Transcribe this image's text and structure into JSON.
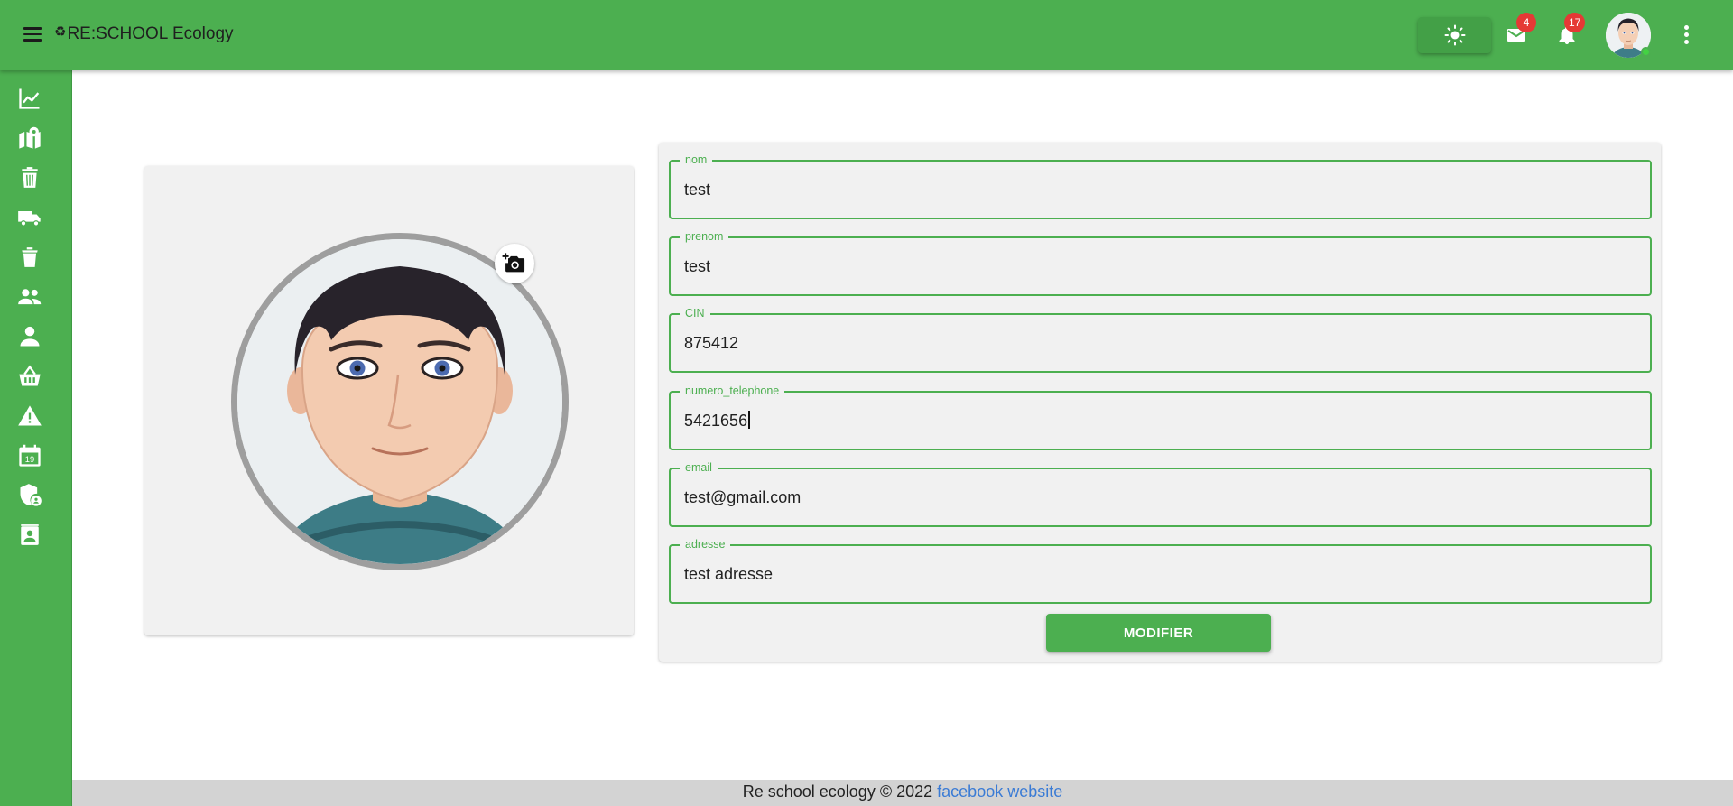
{
  "header": {
    "brand_icon": "recycle-icon",
    "title": "RE:SCHOOL Ecology",
    "messages_count": "4",
    "notifications_count": "17",
    "accent_color": "#4caf50"
  },
  "sidebar": {
    "items": [
      {
        "icon": "chart-line-icon"
      },
      {
        "icon": "map-marker-icon"
      },
      {
        "icon": "trash-bin-icon"
      },
      {
        "icon": "truck-icon"
      },
      {
        "icon": "trash-can-icon"
      },
      {
        "icon": "people-icon"
      },
      {
        "icon": "person-icon"
      },
      {
        "icon": "basket-icon"
      },
      {
        "icon": "warning-icon"
      },
      {
        "icon": "calendar-icon",
        "text": "19"
      },
      {
        "icon": "shield-account-icon"
      },
      {
        "icon": "contact-card-icon"
      }
    ]
  },
  "form": {
    "fields": [
      {
        "label": "nom",
        "value": "test"
      },
      {
        "label": "prenom",
        "value": "test"
      },
      {
        "label": "CIN",
        "value": "875412"
      },
      {
        "label": "numero_telephone",
        "value": "5421656"
      },
      {
        "label": "email",
        "value": "test@gmail.com"
      },
      {
        "label": "adresse",
        "value": "test adresse"
      }
    ],
    "submit_label": "MODIFIER"
  },
  "footer": {
    "text": "Re school ecology © 2022",
    "link1": "facebook",
    "link2": "website"
  }
}
